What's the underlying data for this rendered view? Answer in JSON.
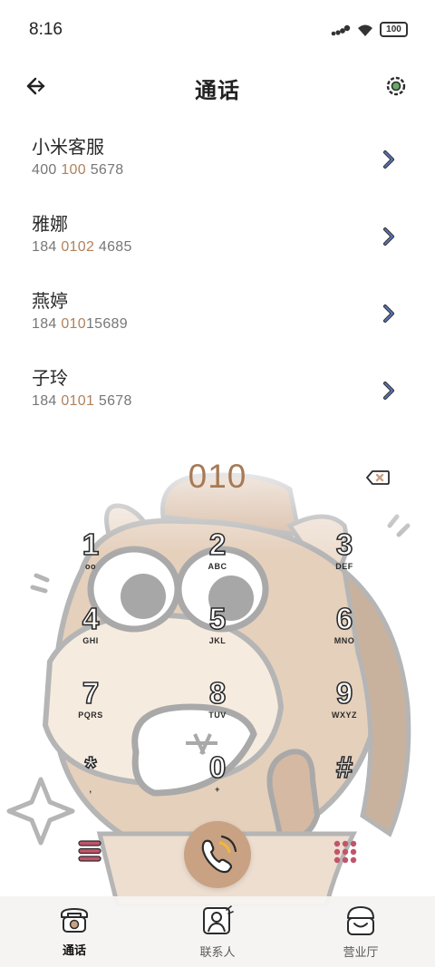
{
  "status": {
    "time": "8:16",
    "battery": "100"
  },
  "header": {
    "title": "通话"
  },
  "contacts": [
    {
      "name": "小米客服",
      "number_pre": "400 ",
      "number_hl": "100",
      "number_post": " 5678"
    },
    {
      "name": "雅娜",
      "number_pre": "184 ",
      "number_hl": "0102",
      "number_post": " 4685"
    },
    {
      "name": "燕婷",
      "number_pre": "184 ",
      "number_hl": "010",
      "number_post": "15689"
    },
    {
      "name": "子玲",
      "number_pre": "184 ",
      "number_hl": "0101",
      "number_post": " 5678"
    }
  ],
  "dialer": {
    "input": "010"
  },
  "keys": [
    {
      "digit": "1",
      "letters": "oo"
    },
    {
      "digit": "2",
      "letters": "ABC"
    },
    {
      "digit": "3",
      "letters": "DEF"
    },
    {
      "digit": "4",
      "letters": "GHI"
    },
    {
      "digit": "5",
      "letters": "JKL"
    },
    {
      "digit": "6",
      "letters": "MNO"
    },
    {
      "digit": "7",
      "letters": "PQRS"
    },
    {
      "digit": "8",
      "letters": "TUV"
    },
    {
      "digit": "9",
      "letters": "WXYZ"
    },
    {
      "digit": "*",
      "letters": ","
    },
    {
      "digit": "0",
      "letters": "+"
    },
    {
      "digit": "#",
      "letters": ""
    }
  ],
  "tabs": [
    {
      "label": "通话",
      "icon": "phone-icon",
      "active": true
    },
    {
      "label": "联系人",
      "icon": "contacts-icon",
      "active": false
    },
    {
      "label": "营业厅",
      "icon": "store-icon",
      "active": false
    }
  ],
  "colors": {
    "accent": "#a77a55",
    "call_button": "#c9a283",
    "chevron": "#5b73b5",
    "menu": "#c2546a"
  }
}
